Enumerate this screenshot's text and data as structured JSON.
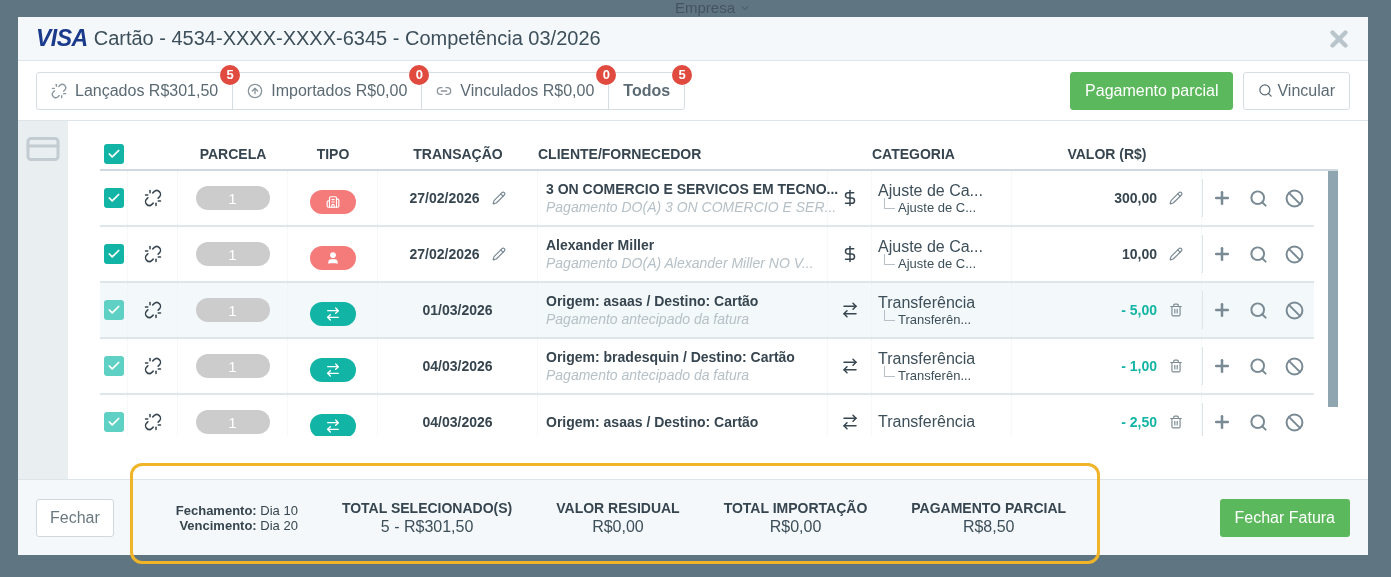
{
  "backdrop": {
    "company": "Empresa"
  },
  "window": {
    "logo": "VISA",
    "title": "Cartão - 4534-XXXX-XXXX-6345 - Competência 03/2026"
  },
  "tabs": [
    {
      "kind": "launched",
      "label": "Lançados R$301,50",
      "badge": "5",
      "selected": false
    },
    {
      "kind": "imported",
      "label": "Importados R$0,00",
      "badge": "0",
      "selected": false
    },
    {
      "kind": "linked",
      "label": "Vinculados R$0,00",
      "badge": "0",
      "selected": false
    },
    {
      "kind": "all",
      "label": "Todos",
      "badge": "5",
      "selected": true
    }
  ],
  "actions": [
    {
      "kind": "primary",
      "label": "Pagamento parcial"
    },
    {
      "kind": "search",
      "label": "Vincular"
    }
  ],
  "table": {
    "all_checked": true,
    "columns": [
      "PARCELA",
      "TIPO",
      "TRANSAÇÃO",
      "CLIENTE/FORNECEDOR",
      "CATEGORIA",
      "VALOR (R$)"
    ],
    "rows": [
      {
        "kind": "company",
        "checked": true,
        "disabled": false,
        "highlighted": false,
        "parcel": "1",
        "date": "27/02/2026",
        "name": "3 ON COMERCIO E SERVICOS EM TECNO...",
        "description": "Pagamento DO(A) 3 ON COMERCIO E SER...",
        "category": "Ajuste de Ca...",
        "subcategory": "Ajuste de C...",
        "value": "300,00"
      },
      {
        "kind": "person",
        "checked": true,
        "disabled": false,
        "highlighted": false,
        "parcel": "1",
        "date": "27/02/2026",
        "name": "Alexander Miller",
        "description": "Pagamento DO(A) Alexander Miller NO V...",
        "category": "Ajuste de Ca...",
        "subcategory": "Ajuste de C...",
        "value": "10,00"
      },
      {
        "kind": "transfer",
        "checked": true,
        "disabled": true,
        "highlighted": true,
        "parcel": "1",
        "date": "01/03/2026",
        "name": "Origem: asaas / Destino: Cartão",
        "description": "Pagamento antecipado da fatura",
        "category": "Transferência",
        "subcategory": "Transferên...",
        "value": "- 5,00"
      },
      {
        "kind": "transfer",
        "checked": true,
        "disabled": true,
        "highlighted": false,
        "parcel": "1",
        "date": "04/03/2026",
        "name": "Origem: bradesquin / Destino: Cartão",
        "description": "Pagamento antecipado da fatura",
        "category": "Transferência",
        "subcategory": "Transferên...",
        "value": "- 1,00"
      },
      {
        "kind": "transfer",
        "checked": true,
        "disabled": true,
        "highlighted": false,
        "parcel": "1",
        "date": "04/03/2026",
        "name": "Origem: asaas / Destino: Cartão",
        "category": "Transferência",
        "value": "- 2,50"
      }
    ]
  },
  "footer": {
    "close": "Fechar",
    "dates": [
      "**Fechamento:** Dia 10",
      "**Vencimento:** Dia 20"
    ],
    "totals": [
      {
        "title": "TOTAL SELECIONADO(S)",
        "value": "5 - R$301,50"
      },
      {
        "title": "VALOR RESIDUAL",
        "value": "R$0,00"
      },
      {
        "title": "TOTAL IMPORTAÇÃO",
        "value": "R$0,00"
      },
      {
        "title": "PAGAMENTO PARCIAL",
        "value": "R$8,50"
      }
    ],
    "submit": "Fechar Fatura"
  }
}
